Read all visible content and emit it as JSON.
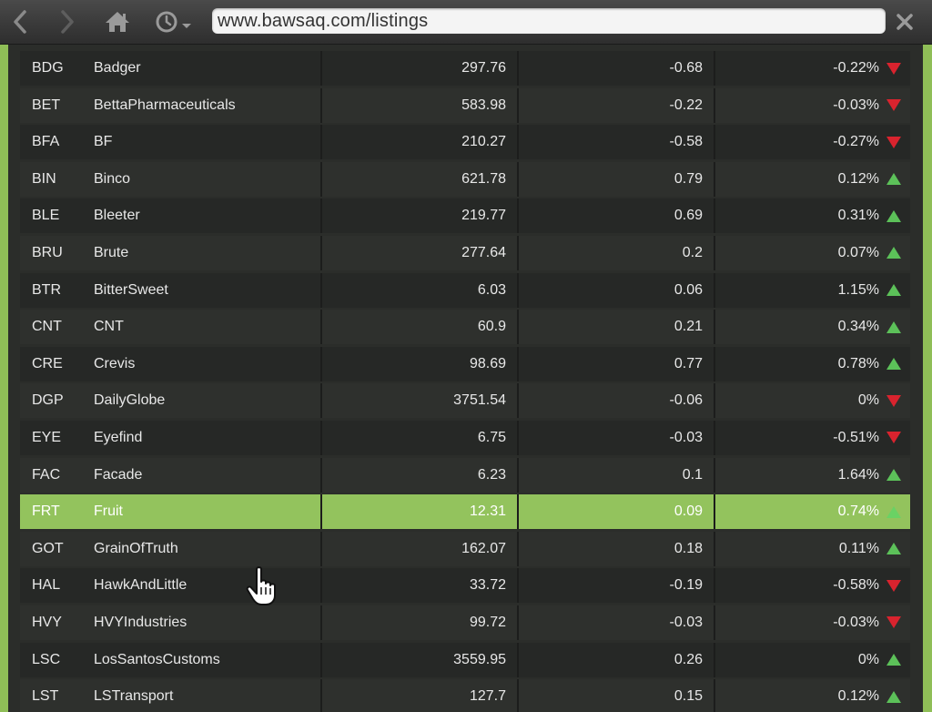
{
  "browser": {
    "url": "www.bawsaq.com/listings",
    "icons": {
      "back": "chevron-left-icon",
      "forward": "chevron-right-icon",
      "home": "home-icon",
      "history": "clock-icon",
      "close": "close-icon"
    }
  },
  "colors": {
    "accent_green": "#93c35d",
    "up_arrow": "#5cc159",
    "down_arrow": "#d9232e",
    "row_dark": "#262826",
    "row_light": "#2e302d"
  },
  "listings": [
    {
      "symbol": "BDG",
      "name": "Badger",
      "price": "297.76",
      "change": "-0.68",
      "pct": "-0.22%",
      "direction": "down"
    },
    {
      "symbol": "BET",
      "name": "BettaPharmaceuticals",
      "price": "583.98",
      "change": "-0.22",
      "pct": "-0.03%",
      "direction": "down"
    },
    {
      "symbol": "BFA",
      "name": "BF",
      "price": "210.27",
      "change": "-0.58",
      "pct": "-0.27%",
      "direction": "down"
    },
    {
      "symbol": "BIN",
      "name": "Binco",
      "price": "621.78",
      "change": "0.79",
      "pct": "0.12%",
      "direction": "up"
    },
    {
      "symbol": "BLE",
      "name": "Bleeter",
      "price": "219.77",
      "change": "0.69",
      "pct": "0.31%",
      "direction": "up"
    },
    {
      "symbol": "BRU",
      "name": "Brute",
      "price": "277.64",
      "change": "0.2",
      "pct": "0.07%",
      "direction": "up"
    },
    {
      "symbol": "BTR",
      "name": "BitterSweet",
      "price": "6.03",
      "change": "0.06",
      "pct": "1.15%",
      "direction": "up"
    },
    {
      "symbol": "CNT",
      "name": "CNT",
      "price": "60.9",
      "change": "0.21",
      "pct": "0.34%",
      "direction": "up"
    },
    {
      "symbol": "CRE",
      "name": "Crevis",
      "price": "98.69",
      "change": "0.77",
      "pct": "0.78%",
      "direction": "up"
    },
    {
      "symbol": "DGP",
      "name": "DailyGlobe",
      "price": "3751.54",
      "change": "-0.06",
      "pct": "0%",
      "direction": "down"
    },
    {
      "symbol": "EYE",
      "name": "Eyefind",
      "price": "6.75",
      "change": "-0.03",
      "pct": "-0.51%",
      "direction": "down"
    },
    {
      "symbol": "FAC",
      "name": "Facade",
      "price": "6.23",
      "change": "0.1",
      "pct": "1.64%",
      "direction": "up"
    },
    {
      "symbol": "FRT",
      "name": "Fruit",
      "price": "12.31",
      "change": "0.09",
      "pct": "0.74%",
      "direction": "up",
      "selected": true
    },
    {
      "symbol": "GOT",
      "name": "GrainOfTruth",
      "price": "162.07",
      "change": "0.18",
      "pct": "0.11%",
      "direction": "up"
    },
    {
      "symbol": "HAL",
      "name": "HawkAndLittle",
      "price": "33.72",
      "change": "-0.19",
      "pct": "-0.58%",
      "direction": "down"
    },
    {
      "symbol": "HVY",
      "name": "HVYIndustries",
      "price": "99.72",
      "change": "-0.03",
      "pct": "-0.03%",
      "direction": "down"
    },
    {
      "symbol": "LSC",
      "name": "LosSantosCustoms",
      "price": "3559.95",
      "change": "0.26",
      "pct": "0%",
      "direction": "up"
    },
    {
      "symbol": "LST",
      "name": "LSTransport",
      "price": "127.7",
      "change": "0.15",
      "pct": "0.12%",
      "direction": "up"
    }
  ]
}
